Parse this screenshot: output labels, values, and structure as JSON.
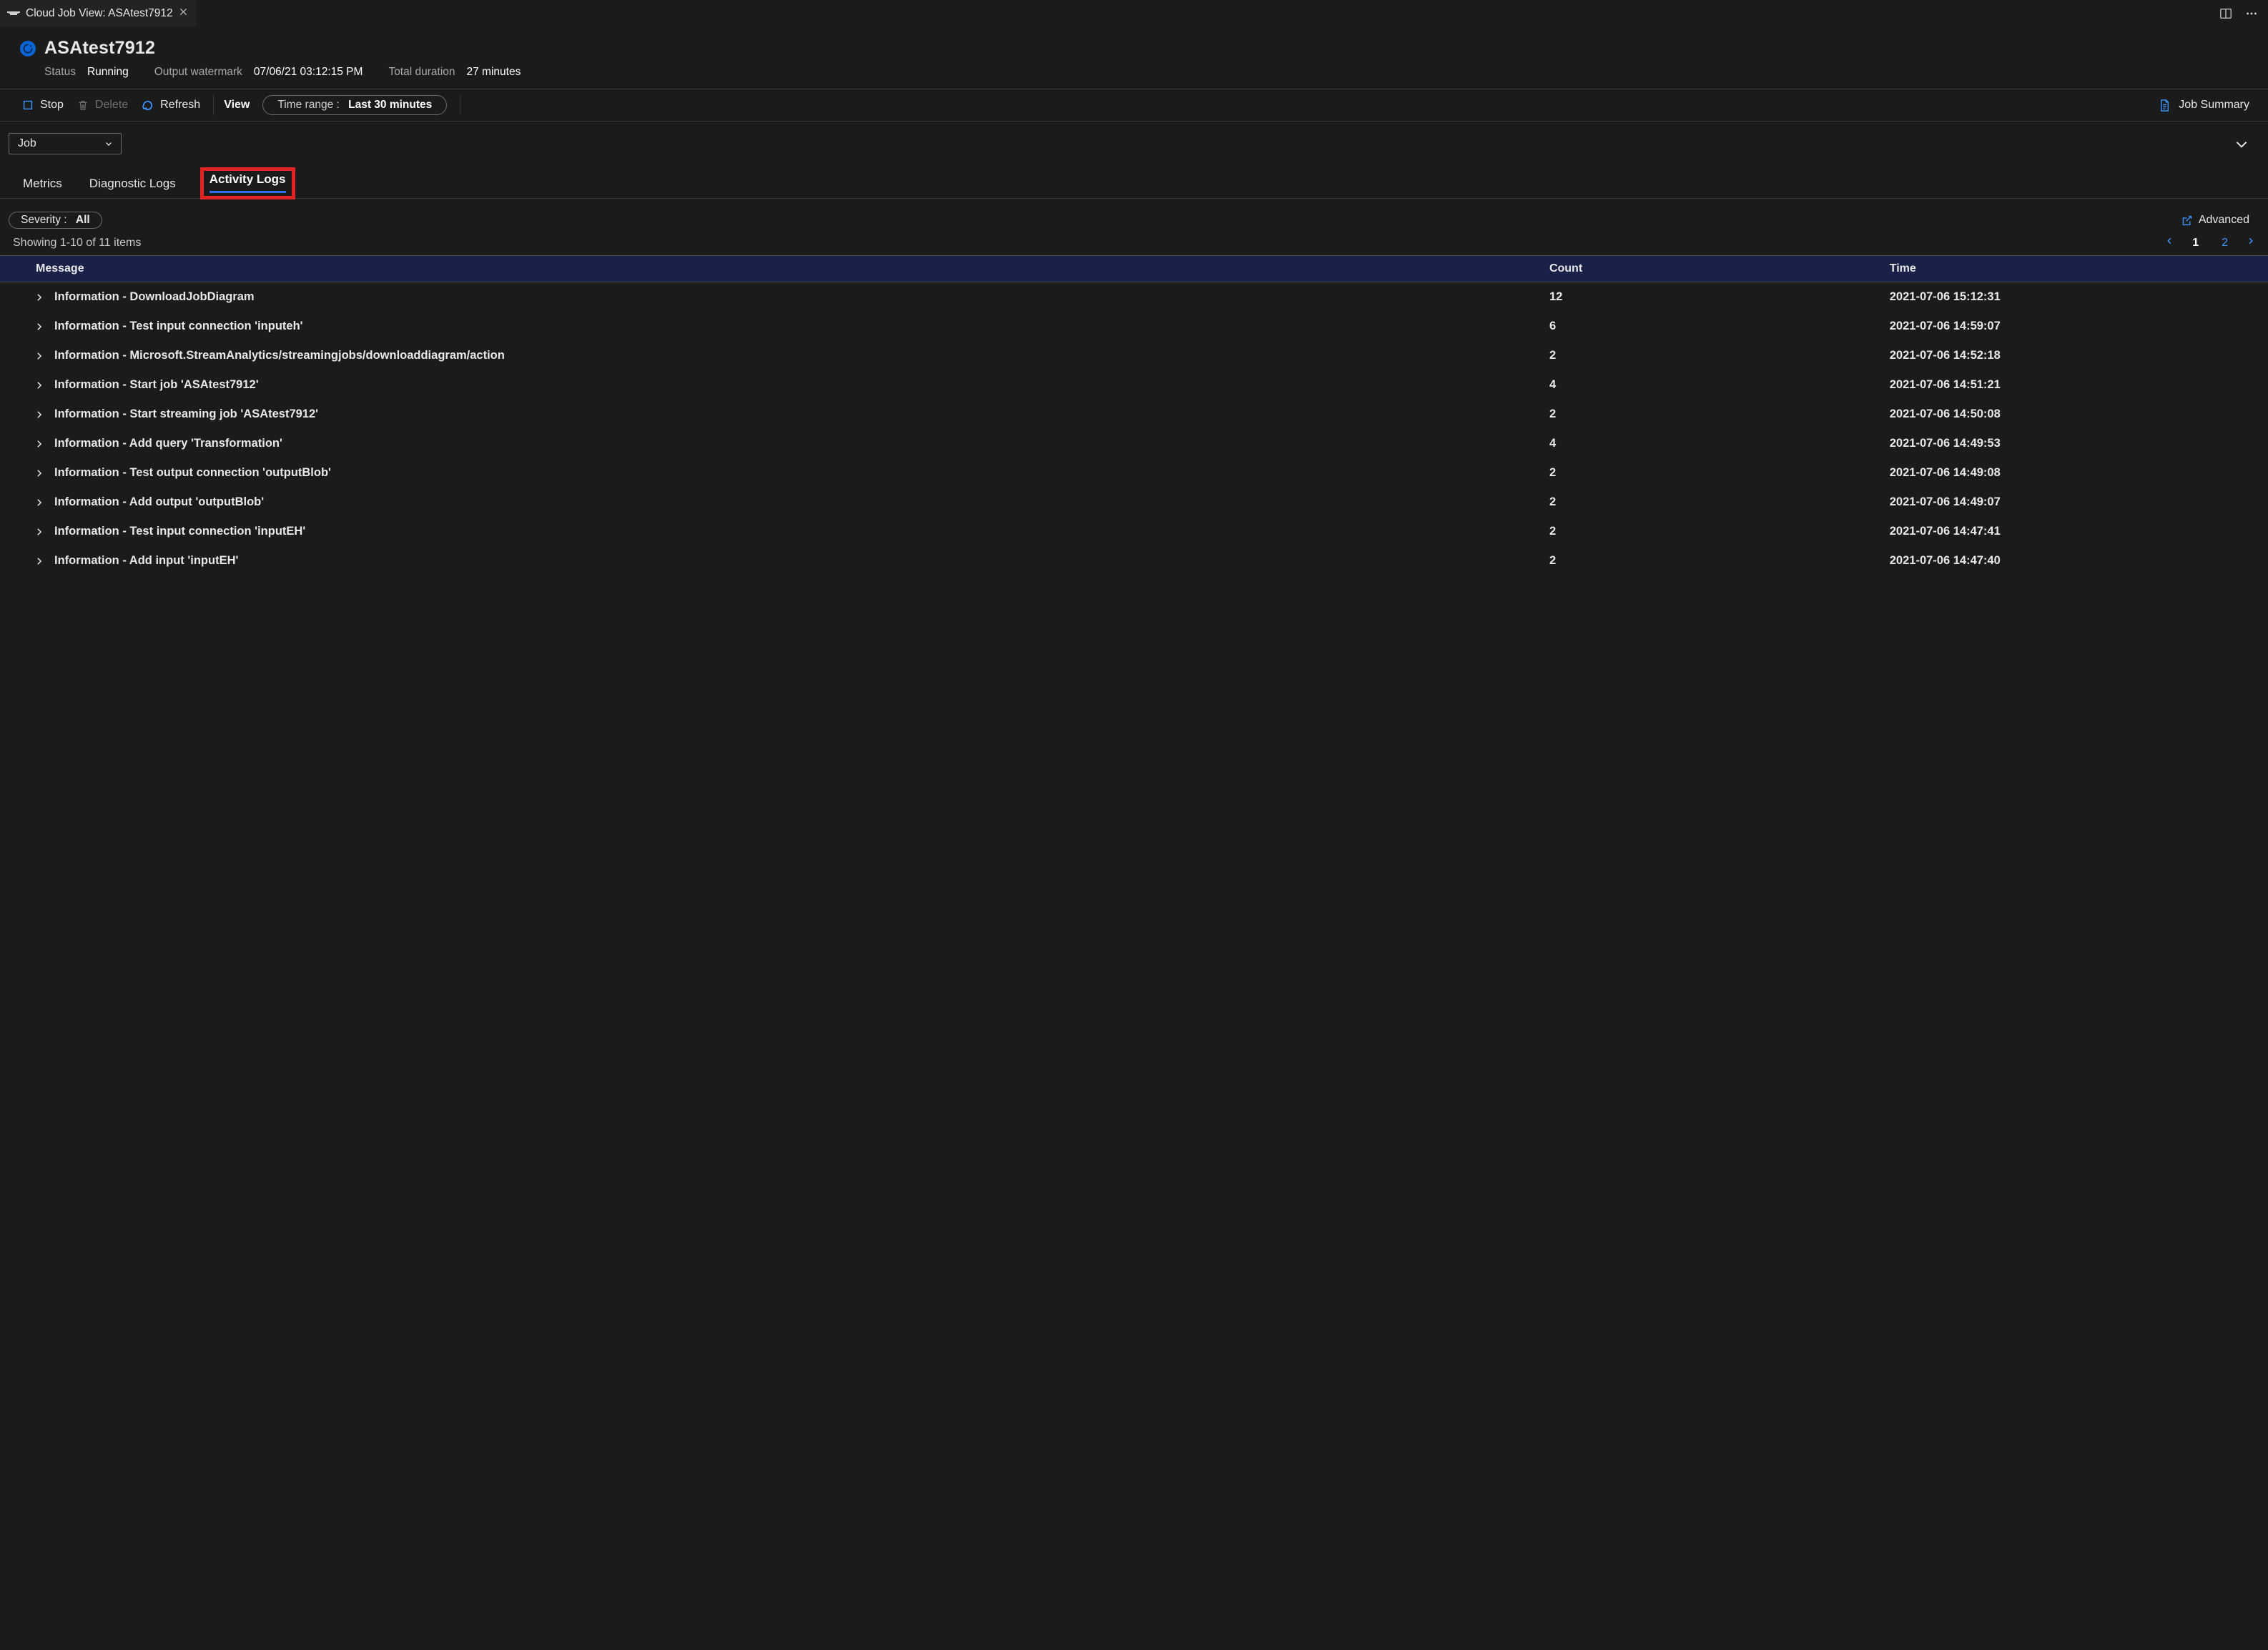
{
  "editorTab": {
    "title": "Cloud Job View: ASAtest7912"
  },
  "header": {
    "jobTitle": "ASAtest7912",
    "statusLabel": "Status",
    "statusValue": "Running",
    "watermarkLabel": "Output watermark",
    "watermarkValue": "07/06/21 03:12:15 PM",
    "durationLabel": "Total duration",
    "durationValue": "27 minutes"
  },
  "toolbar": {
    "stop": "Stop",
    "delete": "Delete",
    "refresh": "Refresh",
    "view": "View",
    "timeRangeLabel": "Time range :",
    "timeRangeValue": "Last 30 minutes",
    "jobSummary": "Job Summary"
  },
  "jobSelector": {
    "value": "Job"
  },
  "pageTabs": {
    "metrics": "Metrics",
    "diagnostic": "Diagnostic Logs",
    "activity": "Activity Logs"
  },
  "filter": {
    "severityLabel": "Severity :",
    "severityValue": "All",
    "advanced": "Advanced"
  },
  "results": {
    "countText": "Showing 1-10 of 11 items",
    "pages": [
      "1",
      "2"
    ],
    "currentPage": "1"
  },
  "table": {
    "headers": {
      "message": "Message",
      "count": "Count",
      "time": "Time"
    },
    "rows": [
      {
        "message": "Information - DownloadJobDiagram",
        "count": "12",
        "time": "2021-07-06 15:12:31"
      },
      {
        "message": "Information - Test input connection 'inputeh'",
        "count": "6",
        "time": "2021-07-06 14:59:07"
      },
      {
        "message": "Information - Microsoft.StreamAnalytics/streamingjobs/downloaddiagram/action",
        "count": "2",
        "time": "2021-07-06 14:52:18"
      },
      {
        "message": "Information - Start job 'ASAtest7912'",
        "count": "4",
        "time": "2021-07-06 14:51:21"
      },
      {
        "message": "Information - Start streaming job 'ASAtest7912'",
        "count": "2",
        "time": "2021-07-06 14:50:08"
      },
      {
        "message": "Information - Add query 'Transformation'",
        "count": "4",
        "time": "2021-07-06 14:49:53"
      },
      {
        "message": "Information - Test output connection 'outputBlob'",
        "count": "2",
        "time": "2021-07-06 14:49:08"
      },
      {
        "message": "Information - Add output 'outputBlob'",
        "count": "2",
        "time": "2021-07-06 14:49:07"
      },
      {
        "message": "Information - Test input connection 'inputEH'",
        "count": "2",
        "time": "2021-07-06 14:47:41"
      },
      {
        "message": "Information - Add input 'inputEH'",
        "count": "2",
        "time": "2021-07-06 14:47:40"
      }
    ]
  }
}
